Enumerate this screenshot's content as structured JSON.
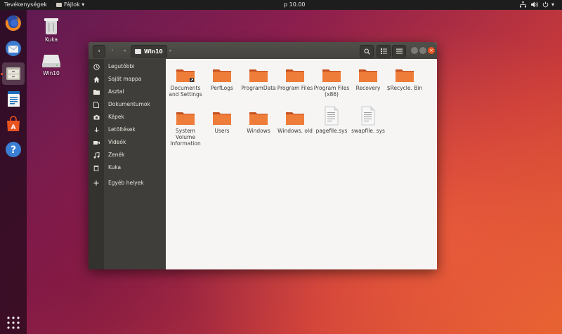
{
  "topbar": {
    "activities": "Tevékenységek",
    "app_menu": "Fájlok",
    "clock": "p 10.00"
  },
  "desktop": {
    "icons": [
      {
        "label": "Kuka"
      },
      {
        "label": "Win10"
      }
    ]
  },
  "window": {
    "breadcrumb": "Win10"
  },
  "sidebar": {
    "items": [
      {
        "label": "Legutóbbi",
        "icon": "clock-icon"
      },
      {
        "label": "Saját mappa",
        "icon": "home-icon"
      },
      {
        "label": "Asztal",
        "icon": "folder-icon"
      },
      {
        "label": "Dokumentumok",
        "icon": "document-icon"
      },
      {
        "label": "Képek",
        "icon": "camera-icon"
      },
      {
        "label": "Letöltések",
        "icon": "download-icon"
      },
      {
        "label": "Videók",
        "icon": "video-icon"
      },
      {
        "label": "Zenék",
        "icon": "music-icon"
      },
      {
        "label": "Kuka",
        "icon": "trash-icon"
      },
      {
        "label": "Egyéb helyek",
        "icon": "plus-icon"
      }
    ]
  },
  "files": [
    {
      "name": "Documents and Settings",
      "type": "folder-link"
    },
    {
      "name": "PerfLogs",
      "type": "folder"
    },
    {
      "name": "ProgramData",
      "type": "folder"
    },
    {
      "name": "Program Files",
      "type": "folder"
    },
    {
      "name": "Program Files (x86)",
      "type": "folder"
    },
    {
      "name": "Recovery",
      "type": "folder"
    },
    {
      "name": "$Recycle. Bin",
      "type": "folder"
    },
    {
      "name": "System Volume Information",
      "type": "folder"
    },
    {
      "name": "Users",
      "type": "folder"
    },
    {
      "name": "Windows",
      "type": "folder"
    },
    {
      "name": "Windows. old",
      "type": "folder"
    },
    {
      "name": "pagefile.sys",
      "type": "file"
    },
    {
      "name": "swapfile. sys",
      "type": "file"
    }
  ],
  "colors": {
    "accent": "#e95420",
    "folder": "#ef7d3a",
    "sidebar_bg": "#3f3e3a",
    "header_bg": "#4a4944"
  }
}
